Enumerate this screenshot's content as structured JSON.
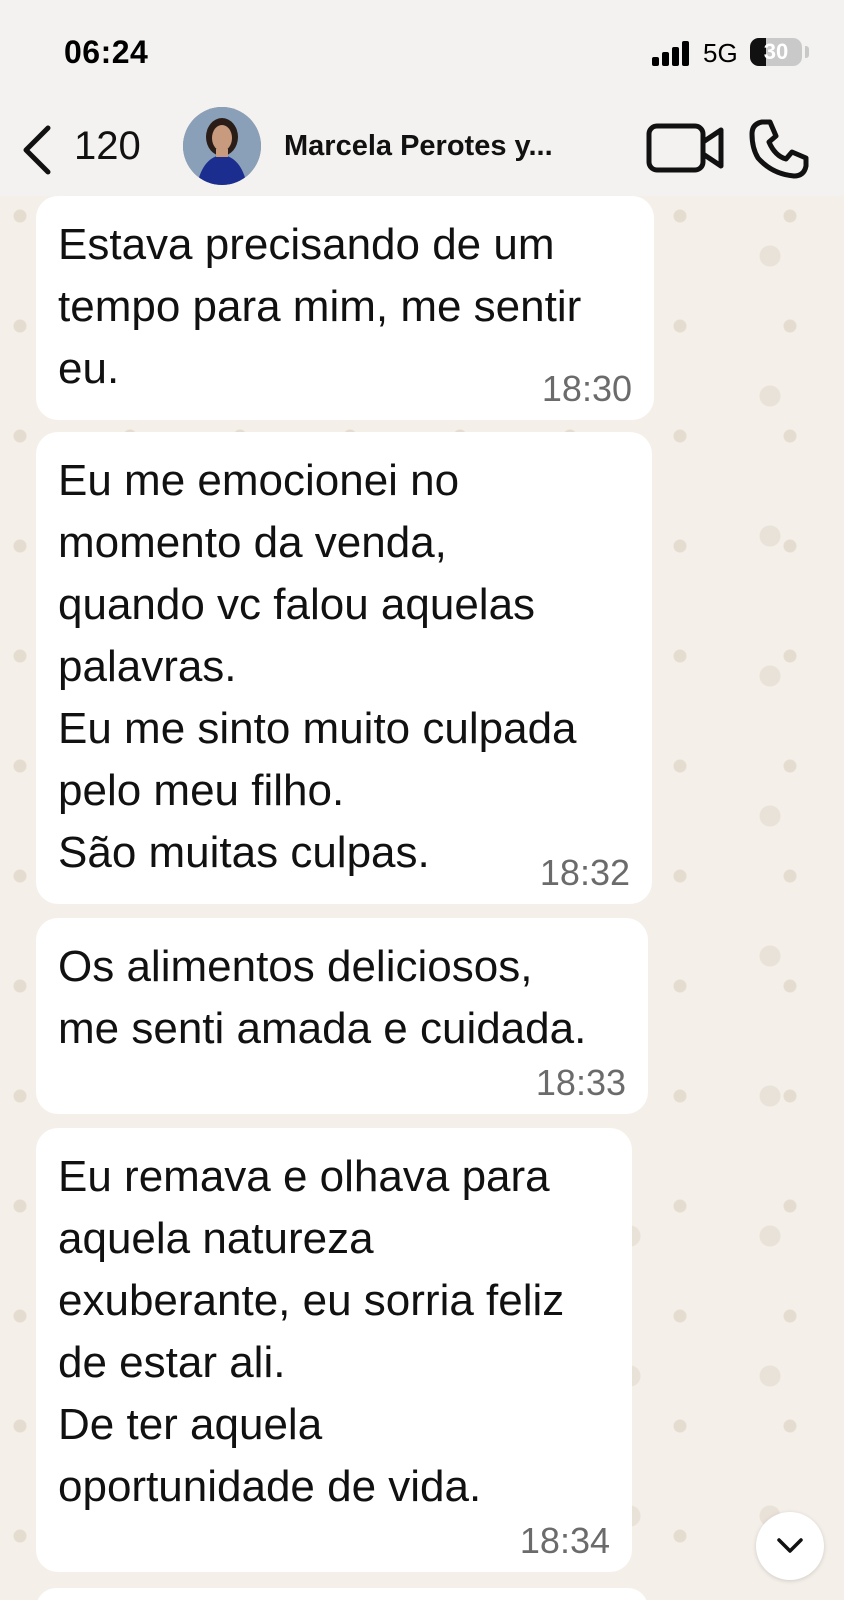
{
  "status_bar": {
    "time": "06:24",
    "network": "5G",
    "battery": "30",
    "battery_level_percent": 30
  },
  "header": {
    "back_count": "120",
    "contact_name": "Marcela Perotes y...",
    "icons": [
      "chevron-left-icon",
      "video-camera-icon",
      "phone-icon"
    ]
  },
  "messages": [
    {
      "text": "Estava precisando de um\ntempo para mim, me sentir\neu.",
      "time": "18:30"
    },
    {
      "text": "Eu me emocionei no\nmomento da venda,\nquando vc falou aquelas\npalavras.\nEu me sinto muito culpada\npelo meu filho.\nSão muitas culpas.",
      "time": "18:32"
    },
    {
      "text": "Os alimentos deliciosos,\nme senti amada e cuidada.",
      "time": "18:33"
    },
    {
      "text": "Eu remava e olhava para\naquela natureza\nexuberante, eu sorria feliz\nde estar ali.\nDe ter aquela\noportunidade de vida.",
      "time": "18:34"
    }
  ],
  "colors": {
    "chat_background": "#f4efe8",
    "bubble": "#ffffff",
    "header": "#f4f2f0",
    "timestamp": "#6b6b6b"
  }
}
